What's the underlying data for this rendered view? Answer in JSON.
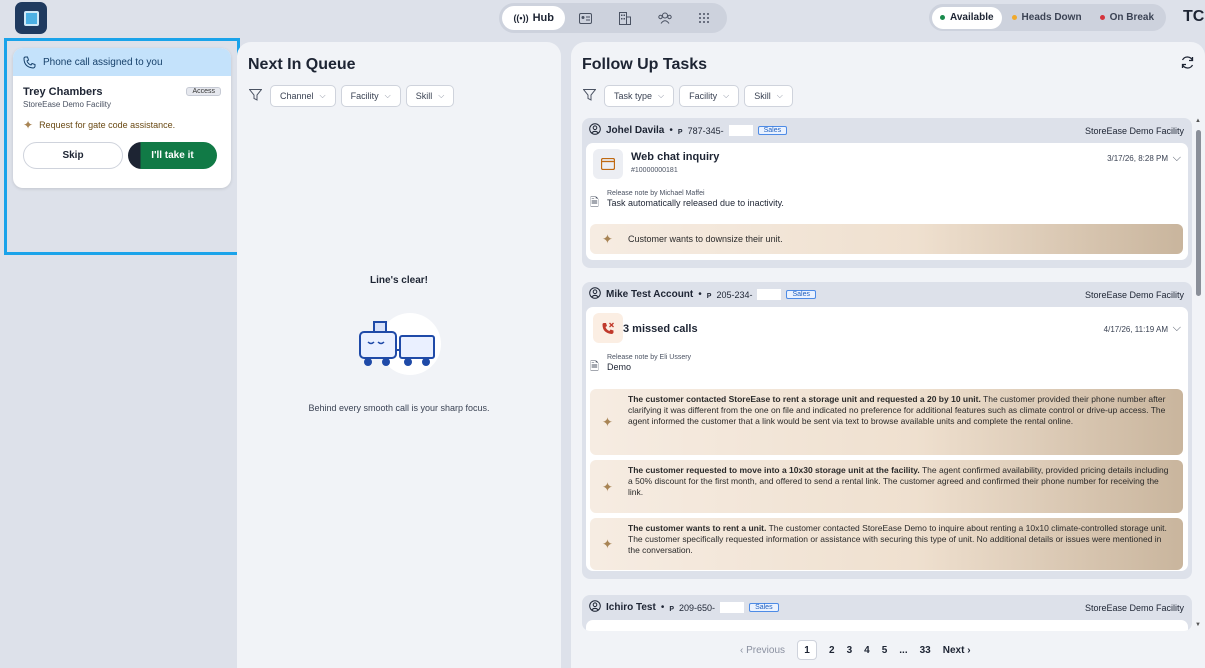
{
  "header": {
    "nav": {
      "hub_label": "Hub",
      "hub_icon": "radio-waves-icon"
    },
    "statuses": [
      {
        "label": "Available",
        "color": "#1a8b4c"
      },
      {
        "label": "Heads Down",
        "color": "#f0a92b"
      },
      {
        "label": "On Break",
        "color": "#d4343c"
      }
    ],
    "avatar_initials": "TC"
  },
  "incoming_call": {
    "header": "Phone call assigned to you",
    "name": "Trey Chambers",
    "facility": "StoreEase Demo Facility",
    "badge": "Access",
    "request": "Request for gate code assistance.",
    "skip_label": "Skip",
    "take_label": "I'll take it"
  },
  "queue": {
    "title": "Next In Queue",
    "filters": [
      "Channel",
      "Facility",
      "Skill"
    ],
    "empty_title": "Line's clear!",
    "empty_message": "Behind every smooth call is your sharp focus."
  },
  "follow_up": {
    "title": "Follow Up Tasks",
    "filters": [
      "Task type",
      "Facility",
      "Skill"
    ],
    "tasks": [
      {
        "name": "Johel Davila",
        "phone": "787-345-",
        "tag": "Sales",
        "facility": "StoreEase Demo Facility",
        "title": "Web chat inquiry",
        "subtitle": "#10000000181",
        "date": "3/17/26, 8:28 PM",
        "note_by": "Release note by Michael Maffei",
        "note": "Task automatically released due to inactivity.",
        "summaries": [
          {
            "bold": "",
            "text": "Customer wants to downsize their unit."
          }
        ]
      },
      {
        "name": "Mike Test Account",
        "phone": "205-234-",
        "tag": "Sales",
        "facility": "StoreEase Demo Facility",
        "title": "3 missed calls",
        "date": "4/17/26, 11:19 AM",
        "note_by": "Release note by Eli Ussery",
        "note": "Demo",
        "summaries": [
          {
            "bold": "The customer contacted StoreEase to rent a storage unit and requested a 20 by 10 unit.",
            "text": " The customer provided their phone number after clarifying it was different from the one on file and indicated no preference for additional features such as climate control or drive-up access. The agent informed the customer that a link would be sent via text to browse available units and complete the rental online."
          },
          {
            "bold": "The customer requested to move into a 10x30 storage unit at the facility.",
            "text": " The agent confirmed availability, provided pricing details including a 50% discount for the first month, and offered to send a rental link. The customer agreed and confirmed their phone number for receiving the link."
          },
          {
            "bold": "The customer wants to rent a unit.",
            "text": " The customer contacted StoreEase Demo to inquire about renting a 10x10 climate-controlled storage unit. The customer specifically requested information or assistance with securing this type of unit. No additional details or issues were mentioned in the conversation."
          }
        ]
      },
      {
        "name": "Ichiro Test",
        "phone": "209-650-",
        "tag": "Sales",
        "facility": "StoreEase Demo Facility"
      }
    ]
  },
  "pagination": {
    "previous": "Previous",
    "pages": [
      "1",
      "2",
      "3",
      "4",
      "5",
      "...",
      "33"
    ],
    "current": "1",
    "next": "Next"
  }
}
